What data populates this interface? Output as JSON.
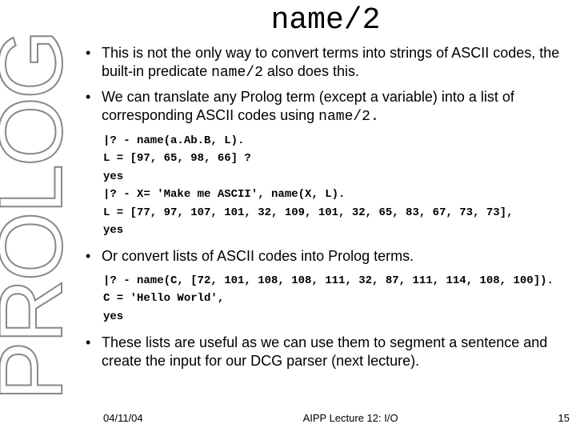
{
  "side_label": "PROLOG",
  "title": "name/2",
  "bullets": {
    "b1_pre": "This is not the only way to convert terms into strings of ASCII codes, the built-in predicate ",
    "b1_code": "name/2",
    "b1_post": " also does this.",
    "b2_pre": "We can translate any Prolog term (except a variable) into a list of corresponding ASCII codes using ",
    "b2_code": "name/2.",
    "b3": "Or convert lists of ASCII codes into Prolog terms.",
    "b4": "These lists are useful as we can use them to segment a sentence and create the input for our DCG parser (next lecture)."
  },
  "code1": "|? - name(a.Ab.B, L).\nL = [97, 65, 98, 66] ?\nyes\n|? - X= 'Make me ASCII', name(X, L).\nL = [77, 97, 107, 101, 32, 109, 101, 32, 65, 83, 67, 73, 73],\nyes",
  "code2": "|? - name(C, [72, 101, 108, 108, 111, 32, 87, 111, 114, 108, 100]).\nC = 'Hello World',\nyes",
  "footer": {
    "date": "04/11/04",
    "center": "AIPP Lecture 12: I/O",
    "page": "15"
  }
}
